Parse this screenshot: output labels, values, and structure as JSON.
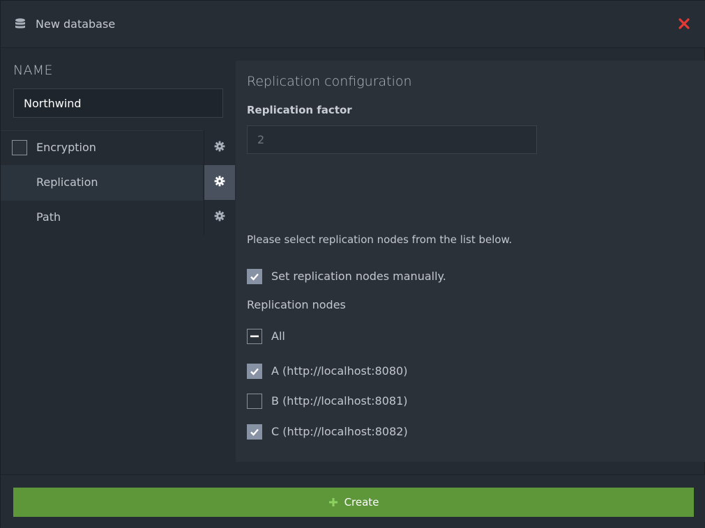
{
  "header": {
    "title": "New database",
    "icon": "database-icon",
    "close_icon": "close-icon",
    "close_color": "#e53935"
  },
  "name": {
    "label": "NAME",
    "value": "Northwind"
  },
  "sidebar": {
    "items": [
      {
        "label": "Encryption",
        "has_checkbox": true,
        "checked": false,
        "active": false
      },
      {
        "label": "Replication",
        "has_checkbox": false,
        "active": true
      },
      {
        "label": "Path",
        "has_checkbox": false,
        "active": false
      }
    ]
  },
  "panel": {
    "title": "Replication configuration",
    "factor_label": "Replication factor",
    "factor_value": "2",
    "hint": "Please select replication nodes from the list below.",
    "manual_label": "Set replication nodes manually.",
    "manual_checked": true,
    "nodes_label": "Replication nodes",
    "all_label": "All",
    "all_state": "indeterminate",
    "nodes": [
      {
        "label": "A (http://localhost:8080)",
        "checked": true
      },
      {
        "label": "B (http://localhost:8081)",
        "checked": false
      },
      {
        "label": "C (http://localhost:8082)",
        "checked": true
      }
    ]
  },
  "footer": {
    "create_label": "Create",
    "create_color": "#5e963a"
  }
}
